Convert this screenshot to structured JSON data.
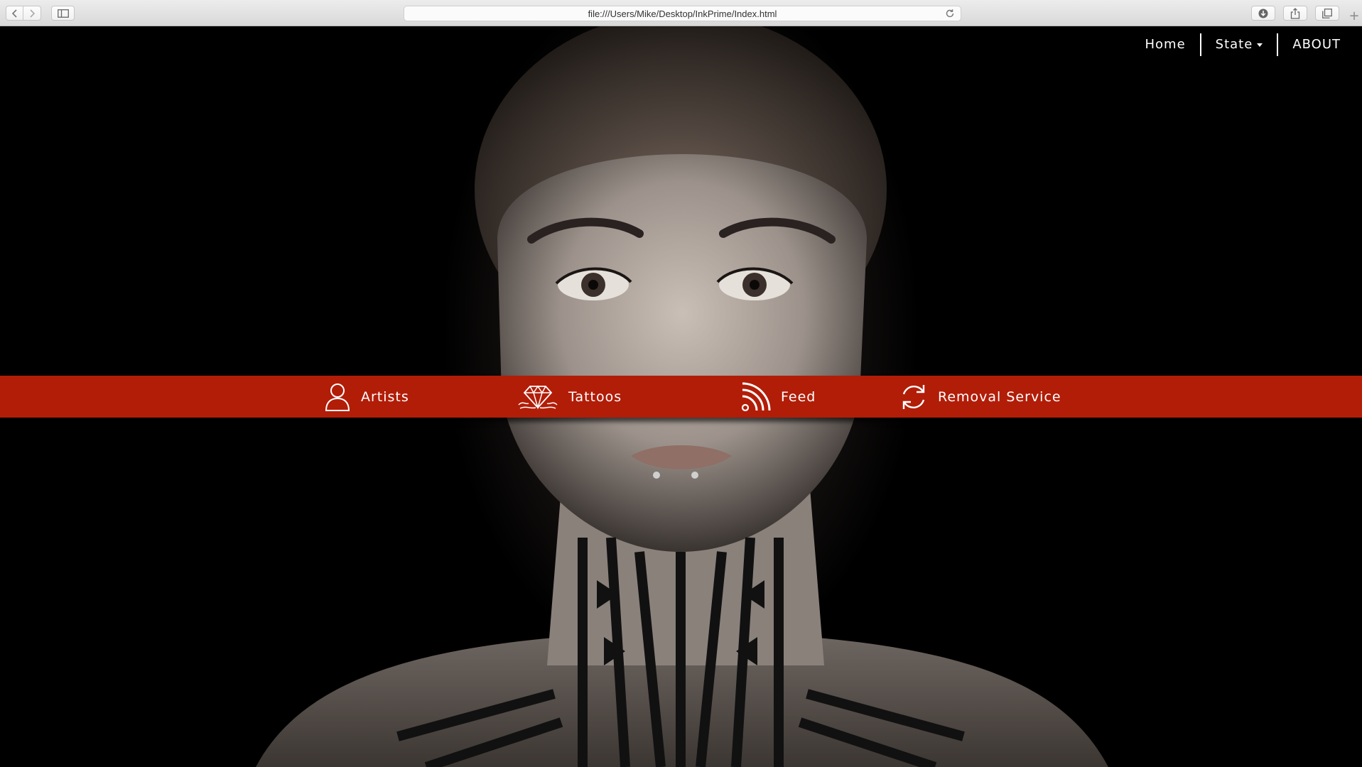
{
  "browser": {
    "url": "file:///Users/Mike/Desktop/InkPrime/Index.html",
    "icons": {
      "back": "chevron-left-icon",
      "forward": "chevron-right-icon",
      "sidebar": "sidebar-icon",
      "reload": "reload-icon",
      "download": "download-icon",
      "share": "share-icon",
      "tabs": "tabs-overview-icon",
      "new_tab": "plus-icon"
    },
    "new_tab_glyph": "+"
  },
  "nav": {
    "items": [
      {
        "label": "Home"
      },
      {
        "label": "State"
      },
      {
        "label": "ABOUT"
      }
    ]
  },
  "services": {
    "items": [
      {
        "label": "Artists",
        "icon": "user-icon"
      },
      {
        "label": "Tattoos",
        "icon": "diamond-icon"
      },
      {
        "label": "Feed",
        "icon": "rss-feed-icon"
      },
      {
        "label": "Removal Service",
        "icon": "refresh-icon"
      }
    ]
  },
  "colors": {
    "band": "#b21d08",
    "nav_text": "#ffffff",
    "page_background": "#000000"
  }
}
